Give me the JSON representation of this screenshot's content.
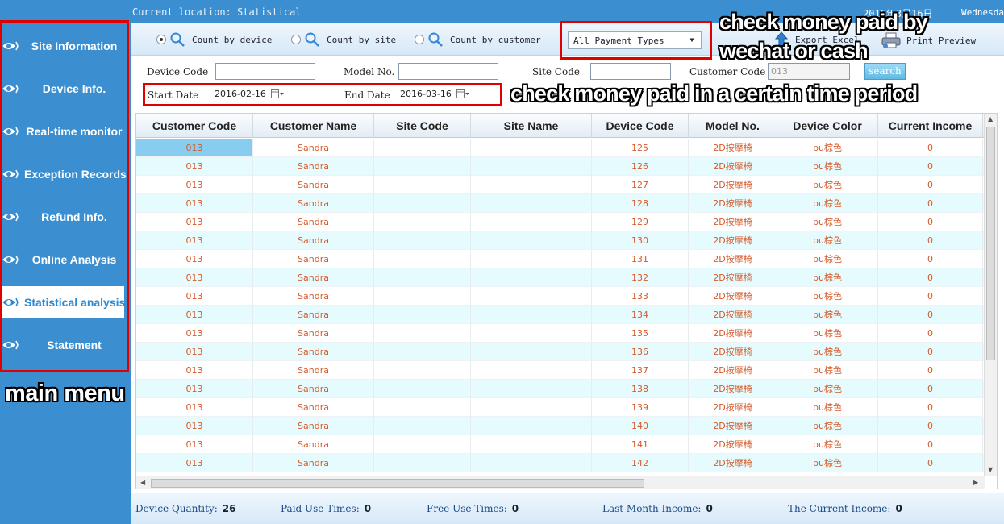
{
  "header": {
    "location_label": "Current location:  Statistical",
    "date_text": "2016年3月16日",
    "day_text": "Wednesday"
  },
  "sidebar": {
    "items": [
      {
        "label": "Site Information",
        "active": false
      },
      {
        "label": "Device Info.",
        "active": false
      },
      {
        "label": "Real-time monitor",
        "active": false
      },
      {
        "label": "Exception Records",
        "active": false
      },
      {
        "label": "Refund Info.",
        "active": false
      },
      {
        "label": "Online Analysis",
        "active": false
      },
      {
        "label": "Statistical analysis",
        "active": true
      },
      {
        "label": "Statement",
        "active": false
      }
    ]
  },
  "toolbar": {
    "radios": [
      {
        "label": "Count by device",
        "checked": true
      },
      {
        "label": "Count by site",
        "checked": false
      },
      {
        "label": "Count by customer",
        "checked": false
      }
    ],
    "payment_type": "All Payment Types",
    "export_label": "Export Excel",
    "print_label": "Print Preview"
  },
  "filters": {
    "device_code_label": "Device Code",
    "model_no_label": "Model No.",
    "site_code_label": "Site Code",
    "customer_code_label": "Customer Code",
    "customer_code_value": "013",
    "start_date_label": "Start Date",
    "start_date_value": "2016-02-16",
    "end_date_label": "End Date",
    "end_date_value": "2016-03-16",
    "search_label": "search"
  },
  "table": {
    "columns": [
      "Customer Code",
      "Customer Name",
      "Site Code",
      "Site Name",
      "Device Code",
      "Model No.",
      "Device Color",
      "Current Income"
    ],
    "rows": [
      [
        "013",
        "Sandra",
        "",
        "",
        "125",
        "2D按摩椅",
        "pu棕色",
        "0"
      ],
      [
        "013",
        "Sandra",
        "",
        "",
        "126",
        "2D按摩椅",
        "pu棕色",
        "0"
      ],
      [
        "013",
        "Sandra",
        "",
        "",
        "127",
        "2D按摩椅",
        "pu棕色",
        "0"
      ],
      [
        "013",
        "Sandra",
        "",
        "",
        "128",
        "2D按摩椅",
        "pu棕色",
        "0"
      ],
      [
        "013",
        "Sandra",
        "",
        "",
        "129",
        "2D按摩椅",
        "pu棕色",
        "0"
      ],
      [
        "013",
        "Sandra",
        "",
        "",
        "130",
        "2D按摩椅",
        "pu棕色",
        "0"
      ],
      [
        "013",
        "Sandra",
        "",
        "",
        "131",
        "2D按摩椅",
        "pu棕色",
        "0"
      ],
      [
        "013",
        "Sandra",
        "",
        "",
        "132",
        "2D按摩椅",
        "pu棕色",
        "0"
      ],
      [
        "013",
        "Sandra",
        "",
        "",
        "133",
        "2D按摩椅",
        "pu棕色",
        "0"
      ],
      [
        "013",
        "Sandra",
        "",
        "",
        "134",
        "2D按摩椅",
        "pu棕色",
        "0"
      ],
      [
        "013",
        "Sandra",
        "",
        "",
        "135",
        "2D按摩椅",
        "pu棕色",
        "0"
      ],
      [
        "013",
        "Sandra",
        "",
        "",
        "136",
        "2D按摩椅",
        "pu棕色",
        "0"
      ],
      [
        "013",
        "Sandra",
        "",
        "",
        "137",
        "2D按摩椅",
        "pu棕色",
        "0"
      ],
      [
        "013",
        "Sandra",
        "",
        "",
        "138",
        "2D按摩椅",
        "pu棕色",
        "0"
      ],
      [
        "013",
        "Sandra",
        "",
        "",
        "139",
        "2D按摩椅",
        "pu棕色",
        "0"
      ],
      [
        "013",
        "Sandra",
        "",
        "",
        "140",
        "2D按摩椅",
        "pu棕色",
        "0"
      ],
      [
        "013",
        "Sandra",
        "",
        "",
        "141",
        "2D按摩椅",
        "pu棕色",
        "0"
      ],
      [
        "013",
        "Sandra",
        "",
        "",
        "142",
        "2D按摩椅",
        "pu棕色",
        "0"
      ]
    ]
  },
  "footer": {
    "device_quantity_label": "Device Quantity:",
    "device_quantity": "26",
    "paid_use_label": "Paid Use Times:",
    "paid_use": "0",
    "free_use_label": "Free Use Times:",
    "free_use": "0",
    "last_month_label": "Last Month Income:",
    "last_month": "0",
    "current_income_label": "The Current Income:",
    "current_income": "0"
  },
  "annotations": {
    "main_menu": "main menu",
    "payment_line1": "check money paid by",
    "payment_line2": "wechat or cash",
    "period": "check money paid in a certain time period"
  },
  "colors": {
    "sidebar_bg": "#3b8fd0",
    "active_text": "#2a8ad4",
    "cell_text": "#d65a2a",
    "alt_row": "#e6fbfd",
    "selected_cell": "#88cdef",
    "annotation_red": "#e00000"
  }
}
